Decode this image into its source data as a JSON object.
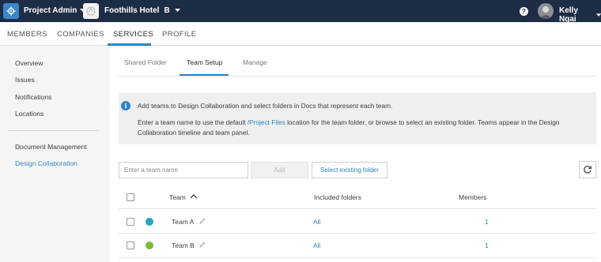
{
  "topbar": {
    "app_title": "Project Admin",
    "app_icon": "gear-icon",
    "project_name": "Foothills Hotel",
    "project_badge": "B",
    "help_label": "?",
    "user_name": "Kelly Ngai"
  },
  "nav_tabs": [
    {
      "label": "MEMBERS"
    },
    {
      "label": "COMPANIES"
    },
    {
      "label": "SERVICES",
      "active": true
    },
    {
      "label": "PROFILE"
    }
  ],
  "sidebar": {
    "items": [
      {
        "label": "Overview"
      },
      {
        "label": "Issues"
      },
      {
        "label": "Notifications"
      },
      {
        "label": "Locations"
      },
      {
        "label": "Document Management"
      },
      {
        "label": "Design Collaboration",
        "active": true
      }
    ]
  },
  "subtabs": [
    {
      "label": "Shared Folder"
    },
    {
      "label": "Team Setup",
      "active": true
    },
    {
      "label": "Manage"
    }
  ],
  "info": {
    "line1": "Add teams to Design Collaboration and select folders in Docs that represent each team.",
    "line2_before": "Enter a team name to use the default ",
    "line2_link": "/Project Files",
    "line2_after": " location for the team folder, or browse to select an existing folder. Teams appear in the Design Collaboration timeline and team panel."
  },
  "controls": {
    "team_input_placeholder": "Enter a team name",
    "team_input_value": "",
    "add_label": "Add",
    "select_label": "Select existing folder"
  },
  "table": {
    "headers": {
      "team": "Team",
      "folders": "Included folders",
      "members": "Members"
    },
    "rows": [
      {
        "name": "Team A",
        "color": "#1fa6bf",
        "folders": "All",
        "members": "1"
      },
      {
        "name": "Team B",
        "color": "#7dbb3a",
        "folders": "All",
        "members": "1"
      }
    ]
  },
  "colors": {
    "topbar": "#1e2d46",
    "accent": "#2c84c6",
    "sidebar_bg": "#f5f5f5"
  }
}
